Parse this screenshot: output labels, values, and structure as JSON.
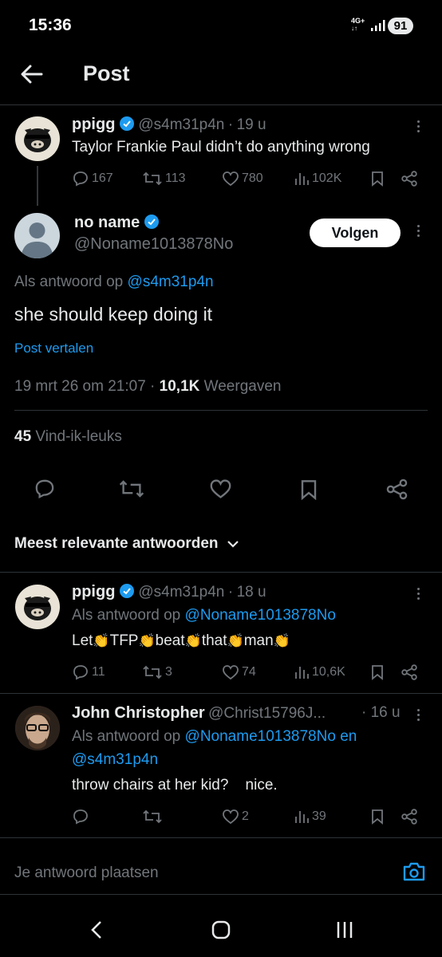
{
  "status": {
    "time": "15:36",
    "network": "4G+",
    "battery": "91"
  },
  "header": {
    "title": "Post"
  },
  "parent": {
    "name": "ppigg",
    "handle": "@s4m31p4n",
    "sep": "·",
    "age": "19 u",
    "text": "Taylor Frankie Paul didn’t do anything wrong",
    "replies": "167",
    "reposts": "113",
    "likes": "780",
    "views": "102K"
  },
  "main": {
    "name": "no name",
    "handle": "@Noname1013878No",
    "follow_label": "Volgen",
    "reply_prefix": "Als antwoord op",
    "reply_to": "@s4m31p4n",
    "text": "she should keep doing it",
    "translate": "Post vertalen",
    "timestamp": "19 mrt 26 om 21:07",
    "sep": "·",
    "views_count": "10,1K",
    "views_label": "Weergaven",
    "likes_count": "45",
    "likes_label": "Vind-ik-leuks"
  },
  "sort": {
    "label": "Meest relevante antwoorden"
  },
  "replies": [
    {
      "name": "ppigg",
      "handle": "@s4m31p4n",
      "sep": "·",
      "age": "18 u",
      "reply_prefix": "Als antwoord op",
      "reply_to": "@Noname1013878No",
      "text_words": [
        "Let",
        "TFP",
        "beat",
        "that",
        "man"
      ],
      "replies": "11",
      "reposts": "3",
      "likes": "74",
      "views": "10,6K"
    },
    {
      "name": "John Christopher",
      "handle": "@Christ15796J...",
      "sep": "·",
      "age": "16 u",
      "reply_prefix": "Als antwoord op",
      "reply_to": "@Noname1013878No",
      "reply_conj": "en",
      "reply_to2": "@s4m31p4n",
      "text": "throw chairs at her kid?    nice.",
      "replies": "",
      "reposts": "",
      "likes": "2",
      "views": "39"
    }
  ],
  "composer": {
    "placeholder": "Je antwoord plaatsen"
  },
  "colors": {
    "accent": "#1d9bf0",
    "muted": "#71767b",
    "background": "#000000",
    "text": "#e7e9ea"
  }
}
